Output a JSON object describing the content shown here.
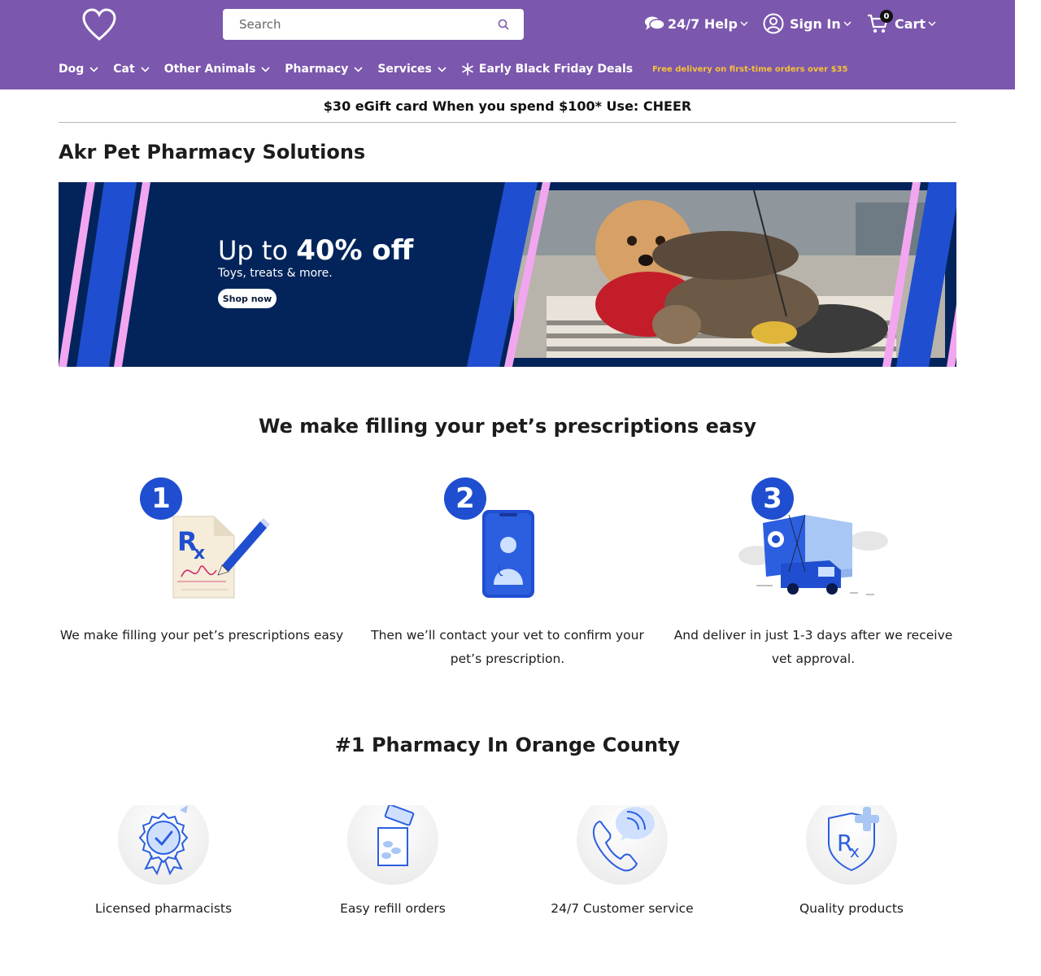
{
  "header": {
    "logo": "heart-logo",
    "search": {
      "placeholder": "Search",
      "value": ""
    },
    "help_label": "24/7 Help",
    "signin_label": "Sign In",
    "cart_label": "Cart",
    "cart_count": "0"
  },
  "nav": {
    "items": [
      {
        "label": "Dog"
      },
      {
        "label": "Cat"
      },
      {
        "label": "Other Animals"
      },
      {
        "label": "Pharmacy"
      },
      {
        "label": "Services"
      }
    ],
    "deals_label": "Early Black Friday Deals",
    "free_delivery": "Free delivery on first-time orders over $35"
  },
  "promo": {
    "text": "$30 eGift card When you spend $100* Use: CHEER"
  },
  "page": {
    "title": "Akr Pet Pharmacy Solutions"
  },
  "banner": {
    "headline_pre": "Up to",
    "headline_bold": "40% off",
    "subtext": "Toys, treats & more.",
    "button": "Shop now"
  },
  "how": {
    "title": "We make filling your pet’s prescriptions easy",
    "steps": [
      {
        "num": "1",
        "text": "We make filling your pet’s prescriptions easy"
      },
      {
        "num": "2",
        "text": "Then we’ll contact your vet to confirm your pet’s prescription."
      },
      {
        "num": "3",
        "text": "And deliver in just 1-3 days after we receive vet approval."
      }
    ]
  },
  "features": {
    "title": "#1 Pharmacy In Orange County",
    "items": [
      {
        "label": "Licensed pharmacists",
        "icon": "award-badge-icon"
      },
      {
        "label": "Easy refill orders",
        "icon": "pill-bottle-icon"
      },
      {
        "label": "24/7 Customer service",
        "icon": "phone-chat-icon"
      },
      {
        "label": "Quality products",
        "icon": "rx-shield-icon"
      }
    ]
  },
  "colors": {
    "header_bg": "#7b57ad",
    "free_delivery": "#f7c137",
    "banner_bg": "#03245a",
    "accent_blue": "#1f4fd0",
    "accent_pink": "#f2a6f0"
  }
}
